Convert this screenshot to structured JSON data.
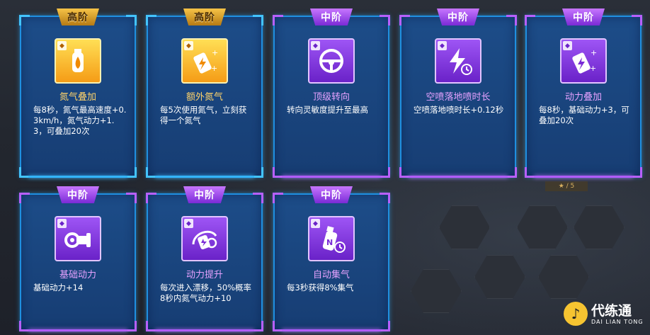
{
  "cards": [
    {
      "tier": "高阶",
      "tier_color": "gold",
      "icon": "nitro-bottle-flame-icon",
      "name": "氮气叠加",
      "desc": "每8秒，氮气最高速度+0.3km/h，氮气动力+1.3，可叠加20次"
    },
    {
      "tier": "高阶",
      "tier_color": "gold",
      "icon": "nitro-canister-plus-icon",
      "name": "额外氮气",
      "desc": "每5次使用氮气，立刻获得一个氮气"
    },
    {
      "tier": "中阶",
      "tier_color": "violet",
      "icon": "steering-wheel-icon",
      "name": "顶级转向",
      "desc": "转向灵敏度提升至最高"
    },
    {
      "tier": "中阶",
      "tier_color": "violet",
      "icon": "lightning-clock-icon",
      "name": "空喷落地喷时长",
      "desc": "空喷落地喷时长+0.12秒"
    },
    {
      "tier": "中阶",
      "tier_color": "violet",
      "icon": "battery-canister-plus-icon",
      "name": "动力叠加",
      "desc": "每8秒，基础动力+3，可叠加20次"
    },
    {
      "tier": "中阶",
      "tier_color": "violet",
      "icon": "engine-icon",
      "name": "基础动力",
      "desc": "基础动力+14"
    },
    {
      "tier": "中阶",
      "tier_color": "violet",
      "icon": "drift-boost-icon",
      "name": "动力提升",
      "desc": "每次进入漂移，50%概率8秒内氮气动力+10"
    },
    {
      "tier": "中阶",
      "tier_color": "violet",
      "icon": "nitro-bottle-clock-icon",
      "name": "自动集气",
      "desc": "每3秒获得8%集气"
    }
  ],
  "logo": {
    "cn": "代练通",
    "en": "DAI LIAN TONG"
  },
  "colors": {
    "gold_text": "#ffd36a",
    "violet_text": "#e6a2ff",
    "card_blue": "#1c4e8c",
    "border_blue": "#1f8fe0"
  }
}
